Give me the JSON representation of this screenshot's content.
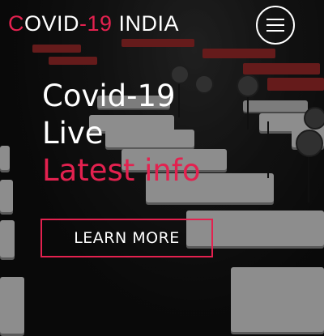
{
  "header": {
    "brand_accent": "C",
    "brand_part1": "OVID",
    "brand_dash_num": "-19",
    "brand_part2": " INDIA",
    "menu_icon": "hamburger-icon"
  },
  "hero": {
    "line1": "Covid-19",
    "line2": "Live",
    "line3": "Latest info",
    "cta_label": "LEARN MORE"
  },
  "colors": {
    "accent": "#e3214f",
    "text": "#ffffff"
  }
}
